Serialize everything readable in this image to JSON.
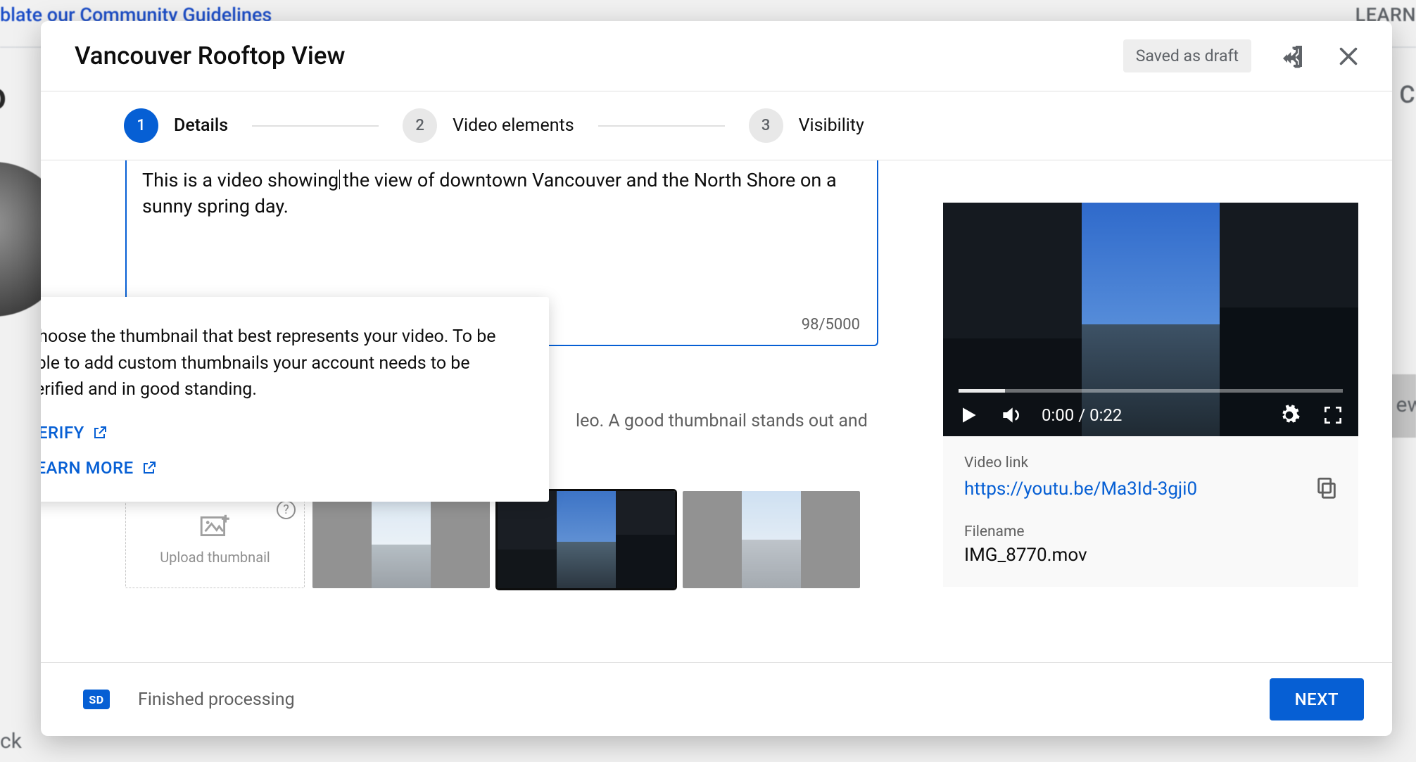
{
  "bg": {
    "top_link": "blate our Community Guidelines",
    "top_right": "LEARN",
    "studio": "lio",
    "cr": "CR",
    "ew": "ew",
    "ck": "ck"
  },
  "modal": {
    "title": "Vancouver Rooftop View",
    "chip": "Saved as draft"
  },
  "stepper": {
    "steps": [
      {
        "num": "1",
        "label": "Details",
        "active": true
      },
      {
        "num": "2",
        "label": "Video elements",
        "active": false
      },
      {
        "num": "3",
        "label": "Visibility",
        "active": false
      }
    ]
  },
  "description": {
    "text_before_caret": "This is a video showing",
    "text_after_caret": "the view of downtown Vancouver and the North Shore on a sunny spring day.",
    "counter": "98/5000"
  },
  "tooltip": {
    "text": "Choose the thumbnail that best represents your video. To be able to add custom thumbnails your account needs to be verified and in good standing.",
    "verify": "VERIFY",
    "learn": "LEARN MORE"
  },
  "thumb_desc_partial": "leo. A good thumbnail stands out and",
  "upload_thumb_label": "Upload thumbnail",
  "preview": {
    "time": "0:00 / 0:22",
    "link_label": "Video link",
    "link": "https://youtu.be/Ma3Id-3gji0",
    "filename_label": "Filename",
    "filename": "IMG_8770.mov"
  },
  "footer": {
    "sd": "SD",
    "status": "Finished processing",
    "next": "NEXT"
  }
}
